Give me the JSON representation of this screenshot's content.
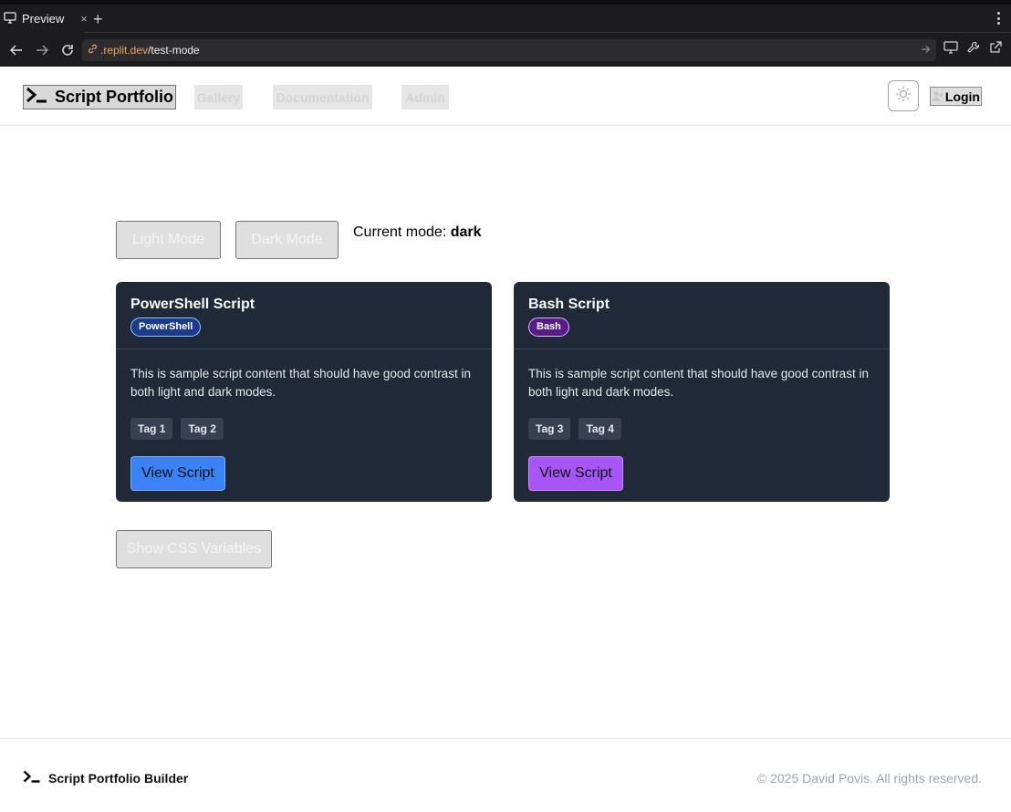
{
  "browser": {
    "tab_label": "Preview",
    "close_glyph": "×",
    "new_tab_glyph": "+",
    "url_domain": ".replit.dev",
    "url_path": "/test-mode"
  },
  "header": {
    "brand": "Script Portfolio",
    "nav": [
      "Gallery",
      "Documentation",
      "Admin"
    ],
    "login_label": "Login"
  },
  "mode": {
    "light_label": "Light Mode",
    "dark_label": "Dark Mode",
    "current_prefix": "Current mode:",
    "current_value": "dark"
  },
  "cards": [
    {
      "title": "PowerShell Script",
      "badge": "PowerShell",
      "badge_color": "#1e3a8a",
      "description": "This is sample script content that should have good contrast in both light and dark modes.",
      "tags": [
        "Tag 1",
        "Tag 2"
      ],
      "button_label": "View Script",
      "button_color": "#3b82f6"
    },
    {
      "title": "Bash Script",
      "badge": "Bash",
      "badge_color": "#581c87",
      "description": "This is sample script content that should have good contrast in both light and dark modes.",
      "tags": [
        "Tag 3",
        "Tag 4"
      ],
      "button_label": "View Script",
      "button_color": "#a855f7"
    }
  ],
  "css_vars_label": "Show CSS Variables",
  "footer": {
    "brand": "Script Portfolio Builder",
    "copyright": "© 2025 David Povis. All rights reserved."
  },
  "icons": {
    "brand": "terminal-icon",
    "theme": "sun-icon",
    "login": "user-icon"
  }
}
